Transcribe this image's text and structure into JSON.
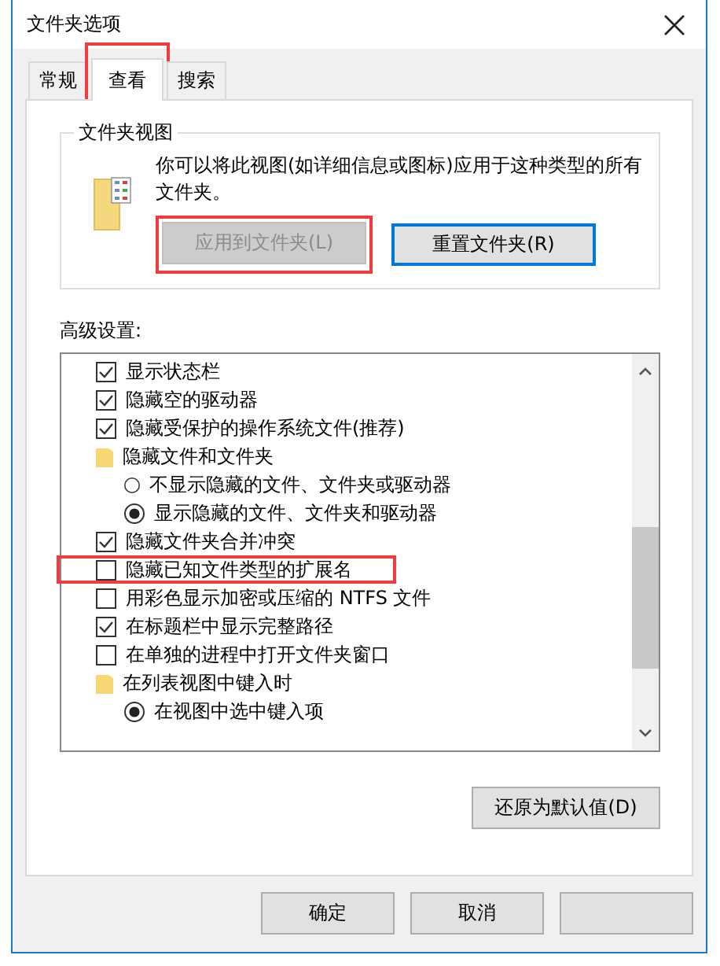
{
  "window": {
    "title": "文件夹选项"
  },
  "tabs": [
    {
      "label": "常规",
      "selected": false,
      "highlighted": false
    },
    {
      "label": "查看",
      "selected": true,
      "highlighted": true
    },
    {
      "label": "搜索",
      "selected": false,
      "highlighted": false
    }
  ],
  "folder_views": {
    "title": "文件夹视图",
    "description": "你可以将此视图(如详细信息或图标)应用于这种类型的所有文件夹。",
    "buttons": [
      {
        "label": "应用到文件夹(L)",
        "disabled": true,
        "focused": false,
        "highlighted": true
      },
      {
        "label": "重置文件夹(R)",
        "disabled": false,
        "focused": true,
        "highlighted": false
      }
    ]
  },
  "advanced": {
    "label": "高级设置:",
    "items": [
      {
        "kind": "checkbox",
        "label": "显示状态栏",
        "checked": true,
        "highlighted": false
      },
      {
        "kind": "checkbox",
        "label": "隐藏空的驱动器",
        "checked": true,
        "highlighted": false
      },
      {
        "kind": "checkbox",
        "label": "隐藏受保护的操作系统文件(推荐)",
        "checked": true,
        "highlighted": false
      },
      {
        "kind": "folder",
        "label": "隐藏文件和文件夹",
        "children": [
          {
            "kind": "radio",
            "label": "不显示隐藏的文件、文件夹或驱动器",
            "selected": false,
            "highlighted": false
          },
          {
            "kind": "radio",
            "label": "显示隐藏的文件、文件夹和驱动器",
            "selected": true,
            "highlighted": false
          }
        ]
      },
      {
        "kind": "checkbox",
        "label": "隐藏文件夹合并冲突",
        "checked": true,
        "highlighted": false
      },
      {
        "kind": "checkbox",
        "label": "隐藏已知文件类型的扩展名",
        "checked": false,
        "highlighted": true
      },
      {
        "kind": "checkbox",
        "label": "用彩色显示加密或压缩的 NTFS 文件",
        "checked": false,
        "highlighted": false
      },
      {
        "kind": "checkbox",
        "label": "在标题栏中显示完整路径",
        "checked": true,
        "highlighted": false
      },
      {
        "kind": "checkbox",
        "label": "在单独的进程中打开文件夹窗口",
        "checked": false,
        "highlighted": false
      },
      {
        "kind": "folder",
        "label": "在列表视图中键入时",
        "children": [
          {
            "kind": "radio",
            "label": "在视图中选中键入项",
            "selected": true,
            "highlighted": false
          }
        ]
      }
    ],
    "restore_button": "还原为默认值(D)"
  },
  "footer_buttons": [
    {
      "kind": "labeled",
      "label": "确定"
    },
    {
      "kind": "labeled",
      "label": "取消"
    },
    {
      "kind": "covered"
    }
  ]
}
